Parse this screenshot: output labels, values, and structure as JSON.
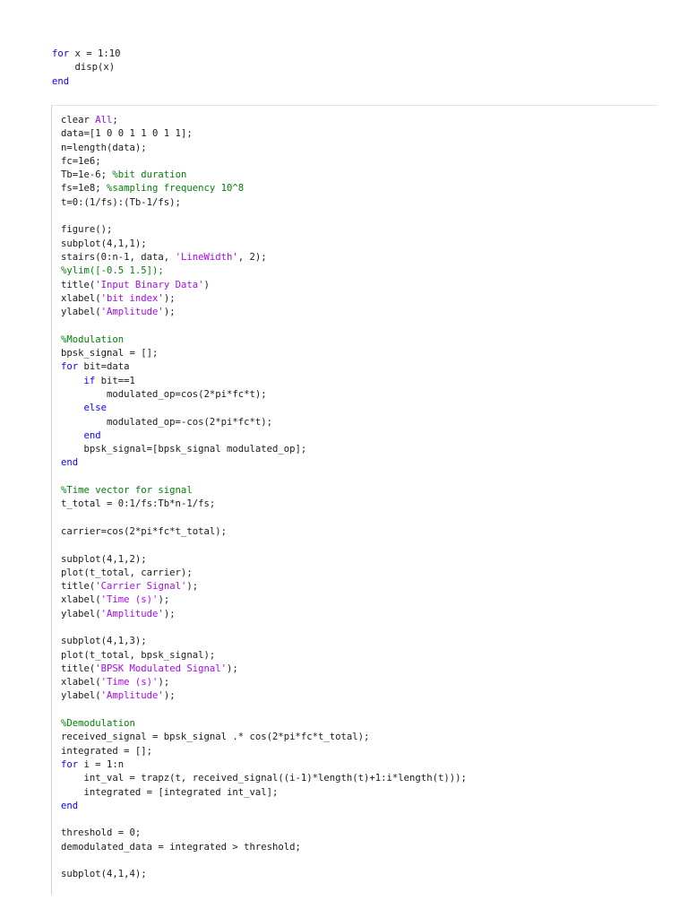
{
  "snippet_1": {
    "lines": [
      [
        {
          "t": "kw",
          "v": "for"
        },
        {
          "t": "",
          "v": " x = 1:10"
        }
      ],
      [
        {
          "t": "",
          "v": "    disp(x)"
        }
      ],
      [
        {
          "t": "kw",
          "v": "end"
        }
      ]
    ]
  },
  "snippet_2": {
    "lines": [
      [
        {
          "t": "",
          "v": "clear "
        },
        {
          "t": "str",
          "v": "All"
        },
        {
          "t": "",
          "v": ";"
        }
      ],
      [
        {
          "t": "",
          "v": "data=[1 0 0 1 1 0 1 1];"
        }
      ],
      [
        {
          "t": "",
          "v": "n=length(data);"
        }
      ],
      [
        {
          "t": "",
          "v": "fc=1e6;"
        }
      ],
      [
        {
          "t": "",
          "v": "Tb=1e-6; "
        },
        {
          "t": "cmt",
          "v": "%bit duration"
        }
      ],
      [
        {
          "t": "",
          "v": "fs=1e8; "
        },
        {
          "t": "cmt",
          "v": "%sampling frequency 10^8"
        }
      ],
      [
        {
          "t": "",
          "v": "t=0:(1/fs):(Tb-1/fs);"
        }
      ],
      [],
      [
        {
          "t": "",
          "v": "figure();"
        }
      ],
      [
        {
          "t": "",
          "v": "subplot(4,1,1);"
        }
      ],
      [
        {
          "t": "",
          "v": "stairs(0:n-1, data, "
        },
        {
          "t": "str",
          "v": "'LineWidth'"
        },
        {
          "t": "",
          "v": ", 2);"
        }
      ],
      [
        {
          "t": "cmt",
          "v": "%ylim([-0.5 1.5]);"
        }
      ],
      [
        {
          "t": "",
          "v": "title("
        },
        {
          "t": "str",
          "v": "'Input Binary Data'"
        },
        {
          "t": "",
          "v": ")"
        }
      ],
      [
        {
          "t": "",
          "v": "xlabel("
        },
        {
          "t": "str",
          "v": "'bit index'"
        },
        {
          "t": "",
          "v": ");"
        }
      ],
      [
        {
          "t": "",
          "v": "ylabel("
        },
        {
          "t": "str",
          "v": "'Amplitude'"
        },
        {
          "t": "",
          "v": ");"
        }
      ],
      [],
      [
        {
          "t": "cmt",
          "v": "%Modulation"
        }
      ],
      [
        {
          "t": "",
          "v": "bpsk_signal = [];"
        }
      ],
      [
        {
          "t": "kw",
          "v": "for"
        },
        {
          "t": "",
          "v": " bit=data"
        }
      ],
      [
        {
          "t": "",
          "v": "    "
        },
        {
          "t": "kw",
          "v": "if"
        },
        {
          "t": "",
          "v": " bit==1"
        }
      ],
      [
        {
          "t": "",
          "v": "        modulated_op=cos(2*pi*fc*t);"
        }
      ],
      [
        {
          "t": "",
          "v": "    "
        },
        {
          "t": "kw",
          "v": "else"
        }
      ],
      [
        {
          "t": "",
          "v": "        modulated_op=-cos(2*pi*fc*t);"
        }
      ],
      [
        {
          "t": "",
          "v": "    "
        },
        {
          "t": "kw",
          "v": "end"
        }
      ],
      [
        {
          "t": "",
          "v": "    bpsk_signal=[bpsk_signal modulated_op];"
        }
      ],
      [
        {
          "t": "kw",
          "v": "end"
        }
      ],
      [],
      [
        {
          "t": "cmt",
          "v": "%Time vector for signal"
        }
      ],
      [
        {
          "t": "",
          "v": "t_total = 0:1/fs:Tb*n-1/fs;"
        }
      ],
      [],
      [
        {
          "t": "",
          "v": "carrier=cos(2*pi*fc*t_total);"
        }
      ],
      [],
      [
        {
          "t": "",
          "v": "subplot(4,1,2);"
        }
      ],
      [
        {
          "t": "",
          "v": "plot(t_total, carrier);"
        }
      ],
      [
        {
          "t": "",
          "v": "title("
        },
        {
          "t": "str",
          "v": "'Carrier Signal'"
        },
        {
          "t": "",
          "v": ");"
        }
      ],
      [
        {
          "t": "",
          "v": "xlabel("
        },
        {
          "t": "str",
          "v": "'Time (s)'"
        },
        {
          "t": "",
          "v": ");"
        }
      ],
      [
        {
          "t": "",
          "v": "ylabel("
        },
        {
          "t": "str",
          "v": "'Amplitude'"
        },
        {
          "t": "",
          "v": ");"
        }
      ],
      [],
      [
        {
          "t": "",
          "v": "subplot(4,1,3);"
        }
      ],
      [
        {
          "t": "",
          "v": "plot(t_total, bpsk_signal);"
        }
      ],
      [
        {
          "t": "",
          "v": "title("
        },
        {
          "t": "str",
          "v": "'BPSK Modulated Signal'"
        },
        {
          "t": "",
          "v": ");"
        }
      ],
      [
        {
          "t": "",
          "v": "xlabel("
        },
        {
          "t": "str",
          "v": "'Time (s)'"
        },
        {
          "t": "",
          "v": ");"
        }
      ],
      [
        {
          "t": "",
          "v": "ylabel("
        },
        {
          "t": "str",
          "v": "'Amplitude'"
        },
        {
          "t": "",
          "v": ");"
        }
      ],
      [],
      [
        {
          "t": "cmt",
          "v": "%Demodulation"
        }
      ],
      [
        {
          "t": "",
          "v": "received_signal = bpsk_signal .* cos(2*pi*fc*t_total);"
        }
      ],
      [
        {
          "t": "",
          "v": "integrated = [];"
        }
      ],
      [
        {
          "t": "kw",
          "v": "for"
        },
        {
          "t": "",
          "v": " i = 1:n"
        }
      ],
      [
        {
          "t": "",
          "v": "    int_val = trapz(t, received_signal((i-1)*length(t)+1:i*length(t)));"
        }
      ],
      [
        {
          "t": "",
          "v": "    integrated = [integrated int_val];"
        }
      ],
      [
        {
          "t": "kw",
          "v": "end"
        }
      ],
      [],
      [
        {
          "t": "",
          "v": "threshold = 0;"
        }
      ],
      [
        {
          "t": "",
          "v": "demodulated_data = integrated > threshold;"
        }
      ],
      [],
      [
        {
          "t": "",
          "v": "subplot(4,1,4);"
        }
      ]
    ]
  },
  "colors": {
    "keyword": "#0e00ff",
    "string": "#a709f5",
    "comment": "#028009",
    "text": "#1a1a1a"
  }
}
